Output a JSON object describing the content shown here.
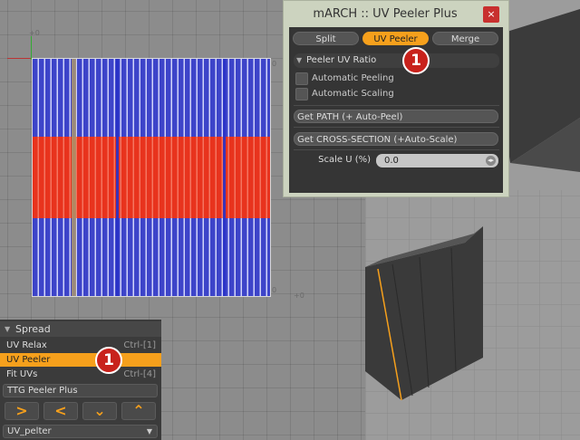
{
  "colors": {
    "uv_blue": "#3d44c9",
    "uv_red": "#e8331d",
    "accent_orange": "#f6a01c",
    "badge_red": "#c8221c",
    "panel_dark": "#353535",
    "window_bg": "#ccd3bf"
  },
  "viewport": {
    "tick_top_left": "+0",
    "tick_top_right": "0",
    "tick_bottom_right": "0",
    "tick_far_right": "+0"
  },
  "peeler_window": {
    "title": "mARCH :: UV Peeler Plus",
    "close_glyph": "×",
    "tabs": [
      "Split",
      "UV Peeler",
      "Merge"
    ],
    "active_tab": "UV Peeler",
    "section_title": "Peeler UV Ratio",
    "checkboxes": [
      "Automatic Peeling",
      "Automatic Scaling"
    ],
    "button_path": "Get PATH (+ Auto-Peel)",
    "button_cross": "Get CROSS-SECTION (+Auto-Scale)",
    "scale_label": "Scale U (%)",
    "scale_value": "0.0"
  },
  "badges": {
    "badge1": "1",
    "badge2": "1"
  },
  "toolbar": {
    "header": "Spread",
    "items": [
      {
        "label": "UV Relax",
        "shortcut": "Ctrl-[1]"
      },
      {
        "label": "UV Peeler",
        "shortcut": ""
      },
      {
        "label": "Fit UVs",
        "shortcut": "Ctrl-[4]"
      }
    ],
    "ttg_label": "TTG Peeler Plus",
    "dropdown_value": "UV_pelter"
  }
}
